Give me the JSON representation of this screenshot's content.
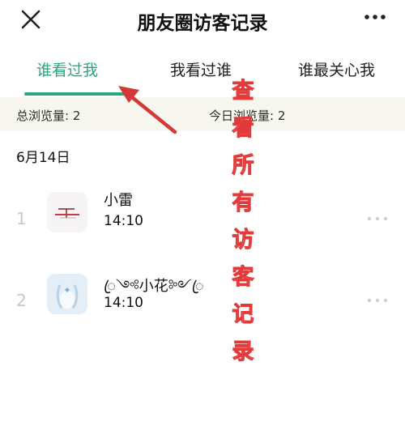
{
  "header": {
    "title": "朋友圈访客记录",
    "close_icon": "close-icon",
    "more_icon": "more-horizontal-icon"
  },
  "tabs": [
    {
      "label": "谁看过我",
      "active": true
    },
    {
      "label": "我看过谁",
      "active": false
    },
    {
      "label": "谁最关心我",
      "active": false
    }
  ],
  "stats": {
    "total_label": "总浏览量: 2",
    "today_label": "今日浏览量: 2"
  },
  "date_header": "6月14日",
  "visitors": [
    {
      "index": "1",
      "name": "小雷",
      "time": "14:10"
    },
    {
      "index": "2",
      "name": "ꦿ༺小花༻ꦿ",
      "time": "14:10"
    }
  ],
  "overlay": {
    "chars": [
      "查",
      "看",
      "所",
      "有",
      "访",
      "客",
      "记",
      "录"
    ]
  },
  "colors": {
    "accent": "#2aa879",
    "stats_bg": "#f7f7ef",
    "annotation": "#d23b35"
  }
}
